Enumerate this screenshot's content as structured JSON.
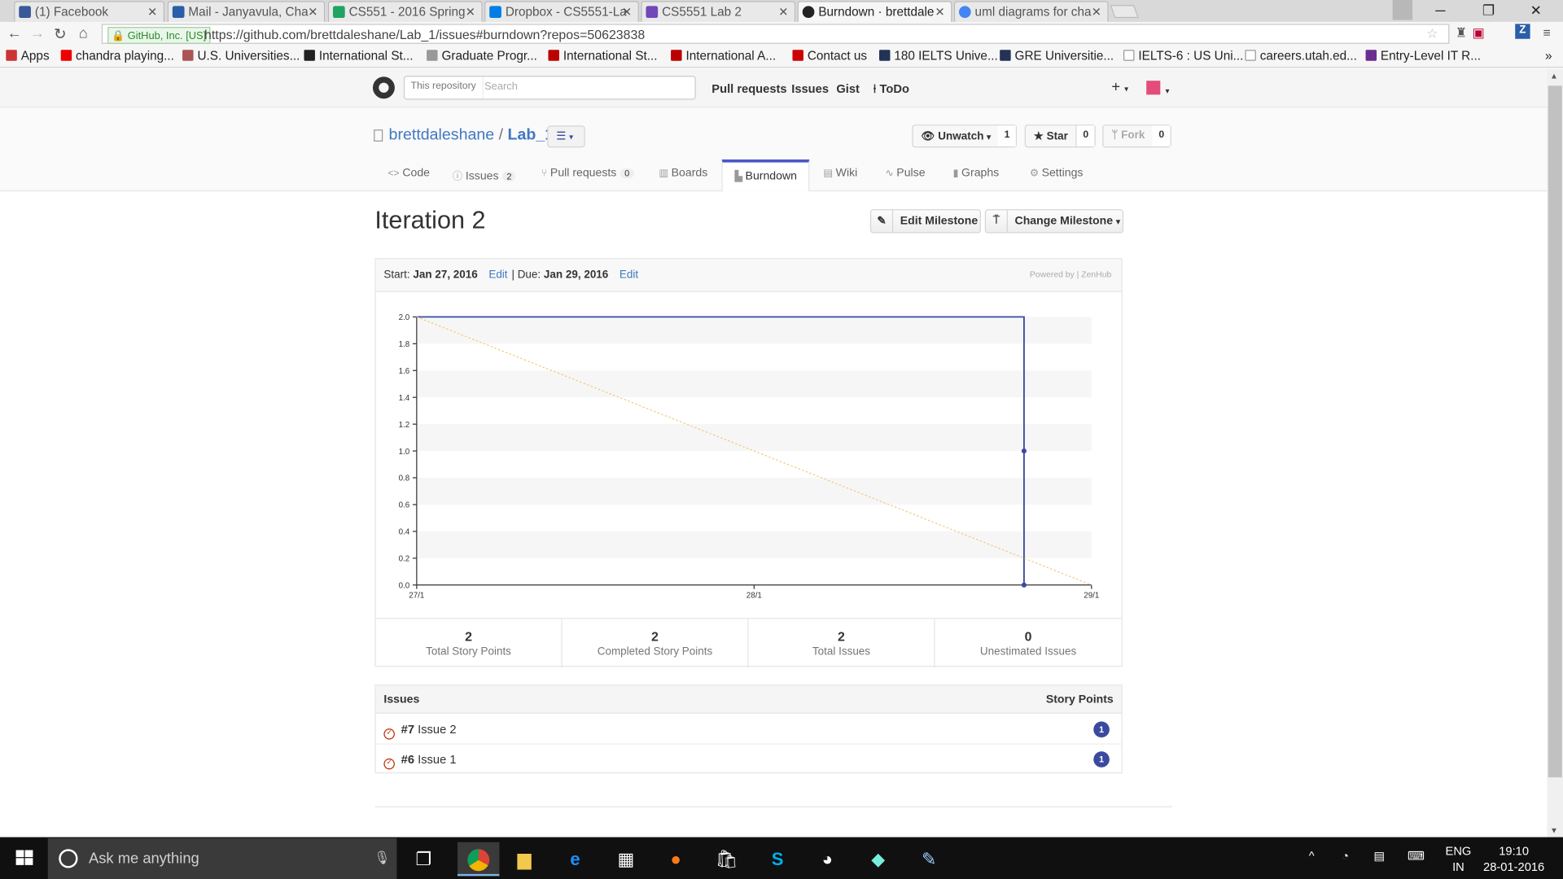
{
  "browser": {
    "tabs": [
      {
        "title": "(1) Facebook",
        "color": "#3b5998"
      },
      {
        "title": "Mail - Janyavula, Cha",
        "color": "#2a5ea8"
      },
      {
        "title": "CS551 - 2016 Spring",
        "color": "#1fa463"
      },
      {
        "title": "Dropbox - CS5551-La",
        "color": "#007ee5"
      },
      {
        "title": "CS5551 Lab 2",
        "color": "#7248b9"
      },
      {
        "title": "Burndown · brettdale",
        "color": "#222222"
      },
      {
        "title": "uml diagrams for cha",
        "color": "#4285f4"
      }
    ],
    "ev_badge": "GitHub, Inc. [US]",
    "url": "https://github.com/brettdaleshane/Lab_1/issues#burndown?repos=50623838",
    "bookmarks": [
      "Apps",
      "chandra playing...",
      "U.S. Universities...",
      "International St...",
      "Graduate Progr...",
      "International St...",
      "International A...",
      "Contact us",
      "180 IELTS Unive...",
      "GRE Universitie...",
      "IELTS-6 : US Uni...",
      "careers.utah.ed...",
      "Entry-Level IT R..."
    ],
    "bookmark_more": "»"
  },
  "github": {
    "search_scope": "This repository",
    "search_placeholder": "Search",
    "topnav": [
      "Pull requests",
      "Issues",
      "Gist",
      "ToDo"
    ],
    "repo_owner": "brettdaleshane",
    "repo_sep": "/",
    "repo_name": "Lab_1",
    "watch": {
      "label": "Unwatch",
      "count": "1"
    },
    "star": {
      "label": "Star",
      "count": "0"
    },
    "fork": {
      "label": "Fork",
      "count": "0"
    },
    "repo_tabs": {
      "code": "Code",
      "issues": "Issues",
      "issues_count": "2",
      "pulls": "Pull requests",
      "pulls_count": "0",
      "boards": "Boards",
      "burndown": "Burndown",
      "wiki": "Wiki",
      "pulse": "Pulse",
      "graphs": "Graphs",
      "settings": "Settings"
    }
  },
  "milestone": {
    "title": "Iteration 2",
    "edit_btn": "Edit Milestone",
    "change_btn": "Change Milestone",
    "start_label": "Start:",
    "start_date": "Jan 27, 2016",
    "edit_link": "Edit",
    "due_sep": "| Due:",
    "due_date": "Jan 29, 2016",
    "powered_by": "Powered by | ZenHub"
  },
  "chart_data": {
    "type": "line",
    "x_labels": [
      "27/1",
      "28/1",
      "29/1"
    ],
    "ylim": [
      0,
      2
    ],
    "yticks": [
      "0.0",
      "0.2",
      "0.4",
      "0.6",
      "0.8",
      "1.0",
      "1.2",
      "1.4",
      "1.6",
      "1.8",
      "2.0"
    ],
    "series": [
      {
        "color": "#3b4a9f",
        "points": [
          [
            0,
            2.0
          ],
          [
            1.8,
            2.0
          ],
          [
            1.8,
            1.0
          ],
          [
            1.8,
            0.0
          ]
        ]
      },
      {
        "color": "#f5c77e",
        "points": [
          [
            0,
            2.0
          ],
          [
            2,
            0.0
          ]
        ],
        "dashed": true
      }
    ]
  },
  "stats": [
    {
      "value": "2",
      "label": "Total Story Points"
    },
    {
      "value": "2",
      "label": "Completed Story Points"
    },
    {
      "value": "2",
      "label": "Total Issues"
    },
    {
      "value": "0",
      "label": "Unestimated Issues"
    }
  ],
  "issues": {
    "header": "Issues",
    "points_header": "Story Points",
    "rows": [
      {
        "number": "#7",
        "title": "Issue 2",
        "points": "1"
      },
      {
        "number": "#6",
        "title": "Issue 1",
        "points": "1"
      }
    ]
  },
  "taskbar": {
    "cortana": "Ask me anything",
    "lang": "ENG",
    "region": "IN",
    "time": "19:10",
    "date": "28-01-2016"
  }
}
